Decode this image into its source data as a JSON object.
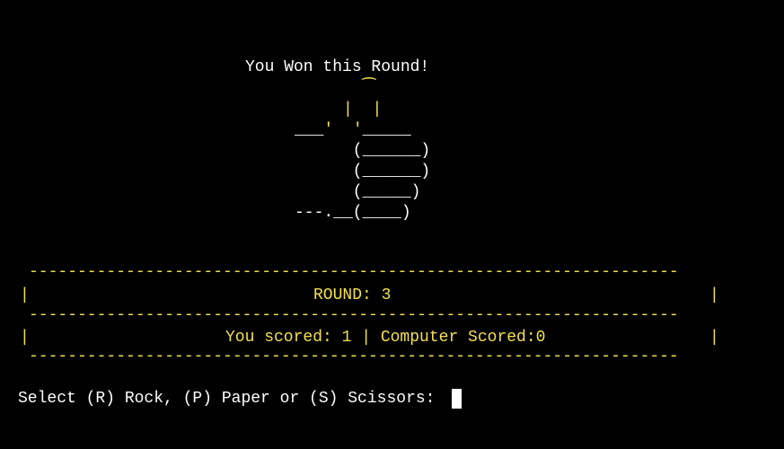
{
  "terminal": {
    "round_message": "You Won this Round!",
    "thumbs_up_art": [
      "      _",
      "     ( )",
      "     | |",
      "___'  '_____",
      "     (______)",
      "     (______)",
      "     (_____)",
      "___.__(____)"
    ],
    "dashes": "-------------------------------------------------------------------",
    "border_char": "|",
    "round_label": "ROUND: 3",
    "score_label": "You scored: 1 | Computer Scored:0",
    "prompt": "Select (R) Rock, (P) Paper or (S) Scissors: "
  },
  "colors": {
    "background": "#000000",
    "text": "#ffffff",
    "accent": "#f4e04d"
  }
}
